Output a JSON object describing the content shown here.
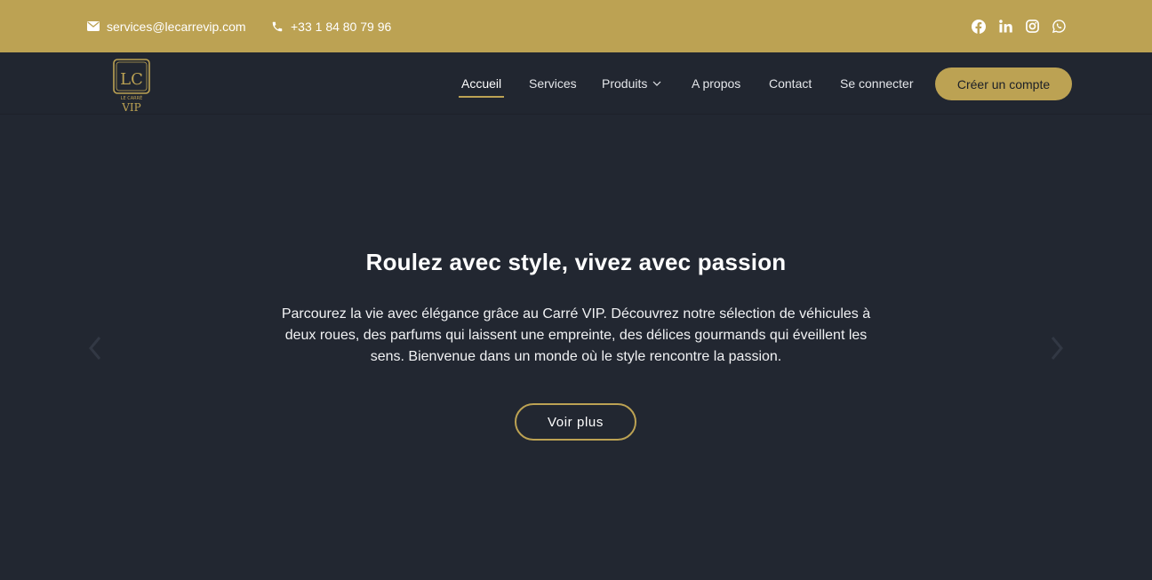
{
  "topbar": {
    "email": "services@lecarrevip.com",
    "phone": "+33 1 84 80 79 96",
    "socials": [
      "facebook-icon",
      "linkedin-icon",
      "instagram-icon",
      "whatsapp-icon"
    ],
    "accent": "#bca253"
  },
  "logo": {
    "monogram": "LC",
    "small_text": "LE CARRÉ",
    "big_text": "VIP"
  },
  "nav": {
    "items": [
      {
        "label": "Accueil",
        "active": true
      },
      {
        "label": "Services"
      },
      {
        "label": "Produits",
        "has_dropdown": true
      },
      {
        "label": "A propos"
      },
      {
        "label": "Contact"
      },
      {
        "label": "Se connecter"
      }
    ],
    "cta": "Créer un compte"
  },
  "hero": {
    "title": "Roulez avec style, vivez avec passion",
    "text": "Parcourez la vie avec élégance grâce au Carré VIP. Découvrez notre sélection de véhicules à deux roues, des parfums qui laissent une empreinte, des délices gourmands qui éveillent les sens. Bienvenue dans un monde où le style rencontre la passion.",
    "button": "Voir plus",
    "background": "#222731"
  }
}
